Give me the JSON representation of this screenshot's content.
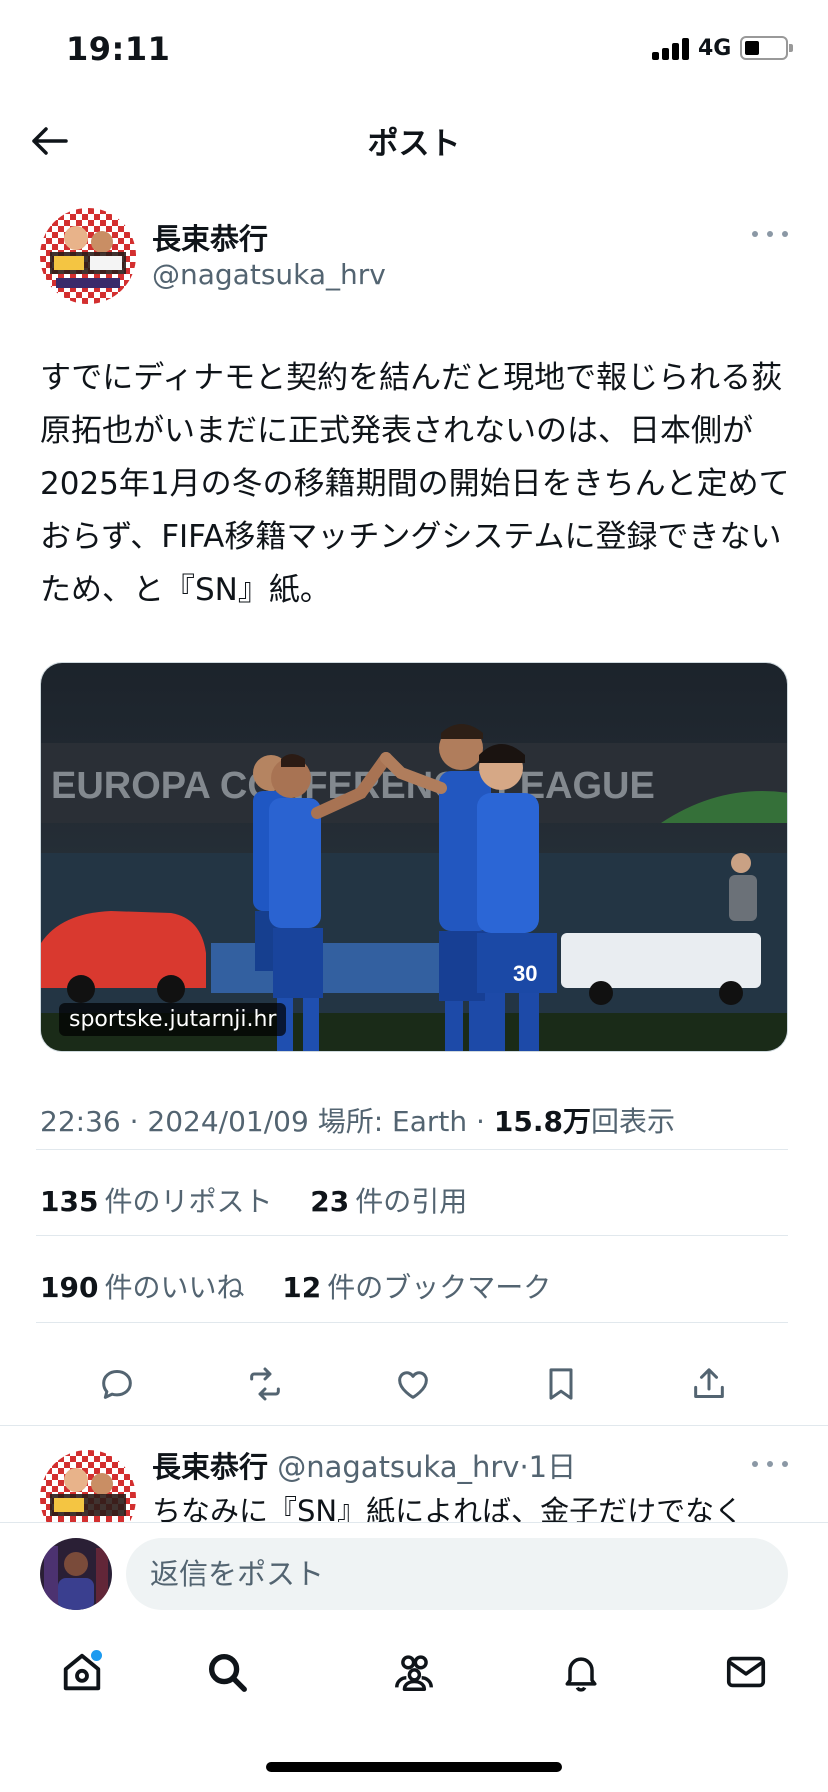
{
  "status_bar": {
    "time": "19:11",
    "network": "4G",
    "battery_level": 0.3
  },
  "header": {
    "title": "ポスト",
    "back_icon": "arrow-left-icon"
  },
  "tweet": {
    "author_name": "長束恭行",
    "author_handle": "@nagatsuka_hrv",
    "text": "すでにディナモと契約を結んだと現地で報じられる荻原拓也がいまだに正式発表されないのは、日本側が2025年1月の冬の移籍期間の開始日をきちんと定めておらず、FIFA移籍マッチングシステムに登録できないため、と『SN』紙。",
    "media_caption": "sportske.jutarnji.hr",
    "media_banner": "EUROPA CONFERENCE LEAGUE",
    "player_number": "30",
    "time": "22:36",
    "date": "2024/01/09",
    "location": "場所: Earth",
    "separator": "·",
    "views_value": "15.8万",
    "views_label": "回表示"
  },
  "stats": {
    "reposts_count": "135",
    "reposts_label": "件のリポスト",
    "quotes_count": "23",
    "quotes_label": "件の引用",
    "likes_count": "190",
    "likes_label": "件のいいね",
    "bookmarks_count": "12",
    "bookmarks_label": "件のブックマーク"
  },
  "actions": [
    "reply-icon",
    "repost-icon",
    "like-icon",
    "bookmark-icon",
    "share-icon"
  ],
  "reply": {
    "author_name": "長束恭行",
    "author_handle": "@nagatsuka_hrv",
    "time": "·1日",
    "text": "ちなみに『SN』紙によれば、金子だけでなく"
  },
  "compose": {
    "placeholder": "返信をポスト"
  },
  "tab_bar": [
    "home-icon",
    "search-icon",
    "communities-icon",
    "notifications-icon",
    "messages-icon"
  ],
  "colors": {
    "accent": "#1d9bf0",
    "text": "#0f1419",
    "secondary": "#536471",
    "divider": "#e1e8ed"
  }
}
